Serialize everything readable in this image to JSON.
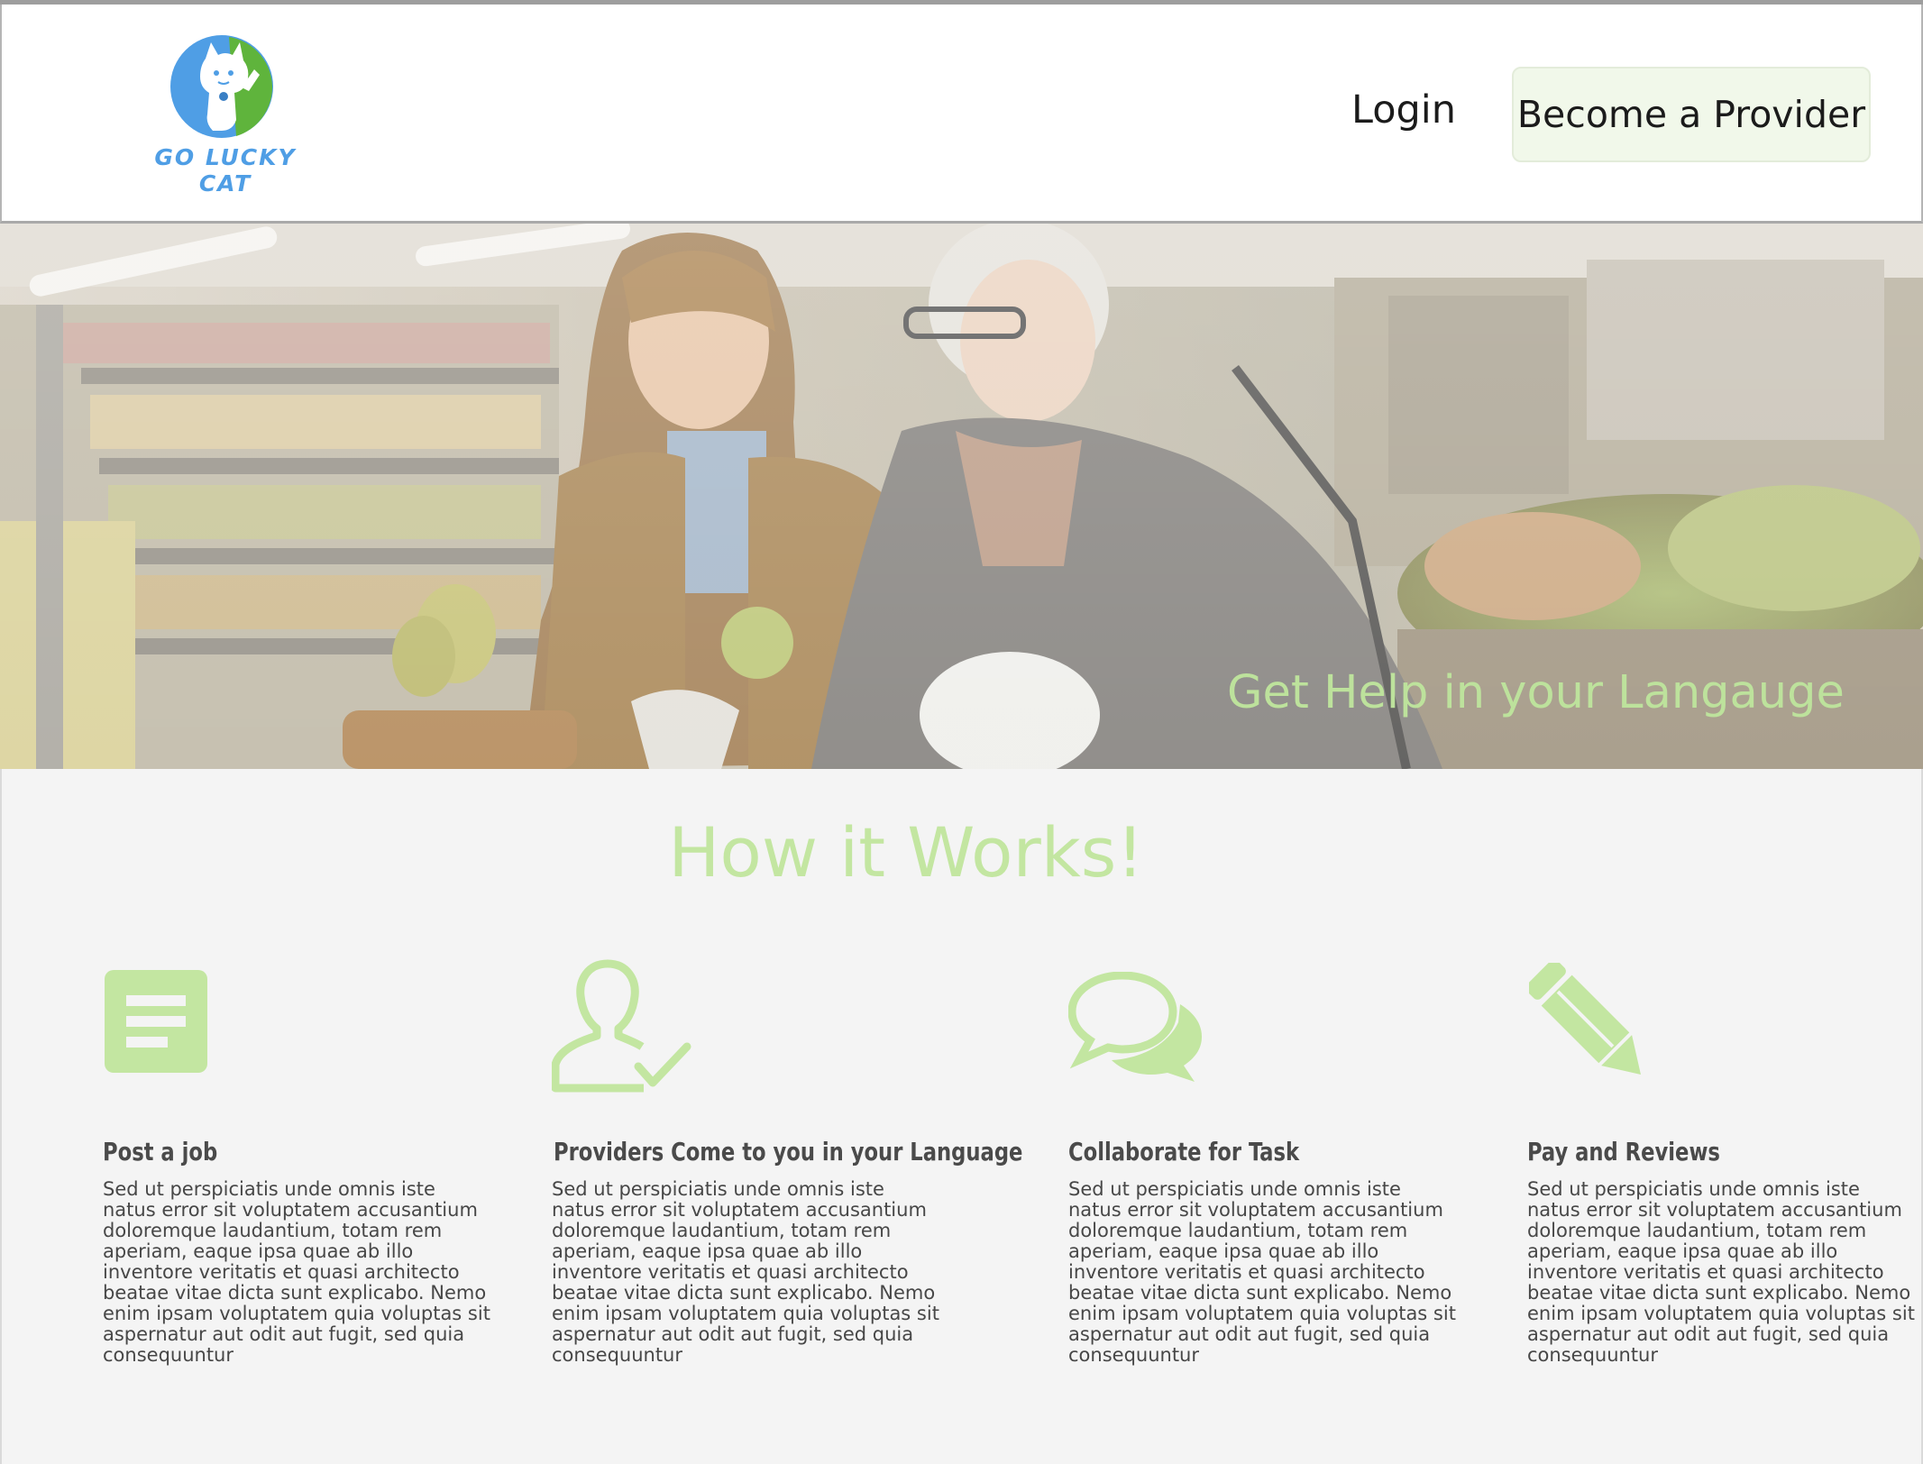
{
  "brand": {
    "name": "GO LUCKY CAT",
    "colors": {
      "blue": "#4f9ee5",
      "green": "#5fb43c",
      "accent": "#bde29c"
    }
  },
  "nav": {
    "login_label": "Login",
    "provider_label": "Become a Provider"
  },
  "hero": {
    "tagline": "Get Help in your Langauge",
    "image": "hero-photo-grocery-shopping"
  },
  "how": {
    "title": "How it Works!",
    "steps": [
      {
        "icon": "document-icon",
        "title": "Post a job",
        "desc": "Sed ut perspiciatis unde omnis iste natus error sit voluptatem accusantium doloremque laudantium, totam rem aperiam, eaque ipsa quae ab illo inventore veritatis et quasi architecto beatae vitae dicta sunt explicabo. Nemo enim ipsam voluptatem quia voluptas sit aspernatur aut odit aut fugit, sed quia consequuntur"
      },
      {
        "icon": "user-check-icon",
        "title": "Providers Come to you in your Language",
        "desc": "Sed ut perspiciatis unde omnis iste natus error sit voluptatem accusantium doloremque laudantium, totam rem aperiam, eaque ipsa quae ab illo inventore veritatis et quasi architecto beatae vitae dicta sunt explicabo. Nemo enim ipsam voluptatem quia voluptas sit aspernatur aut odit aut fugit, sed quia consequuntur"
      },
      {
        "icon": "chat-bubbles-icon",
        "title": "Collaborate for Task",
        "desc": "Sed ut perspiciatis unde omnis iste natus error sit voluptatem accusantium doloremque laudantium, totam rem aperiam, eaque ipsa quae ab illo inventore veritatis et quasi architecto beatae vitae dicta sunt explicabo. Nemo enim ipsam voluptatem quia voluptas sit aspernatur aut odit aut fugit, sed quia consequuntur"
      },
      {
        "icon": "pencil-icon",
        "title": "Pay and Reviews",
        "desc": "Sed ut perspiciatis unde omnis iste natus error sit voluptatem accusantium doloremque laudantium, totam rem aperiam, eaque ipsa quae ab illo inventore veritatis et quasi architecto beatae vitae dicta sunt explicabo. Nemo enim ipsam voluptatem quia voluptas sit aspernatur aut odit aut fugit, sed quia consequuntur"
      }
    ]
  }
}
